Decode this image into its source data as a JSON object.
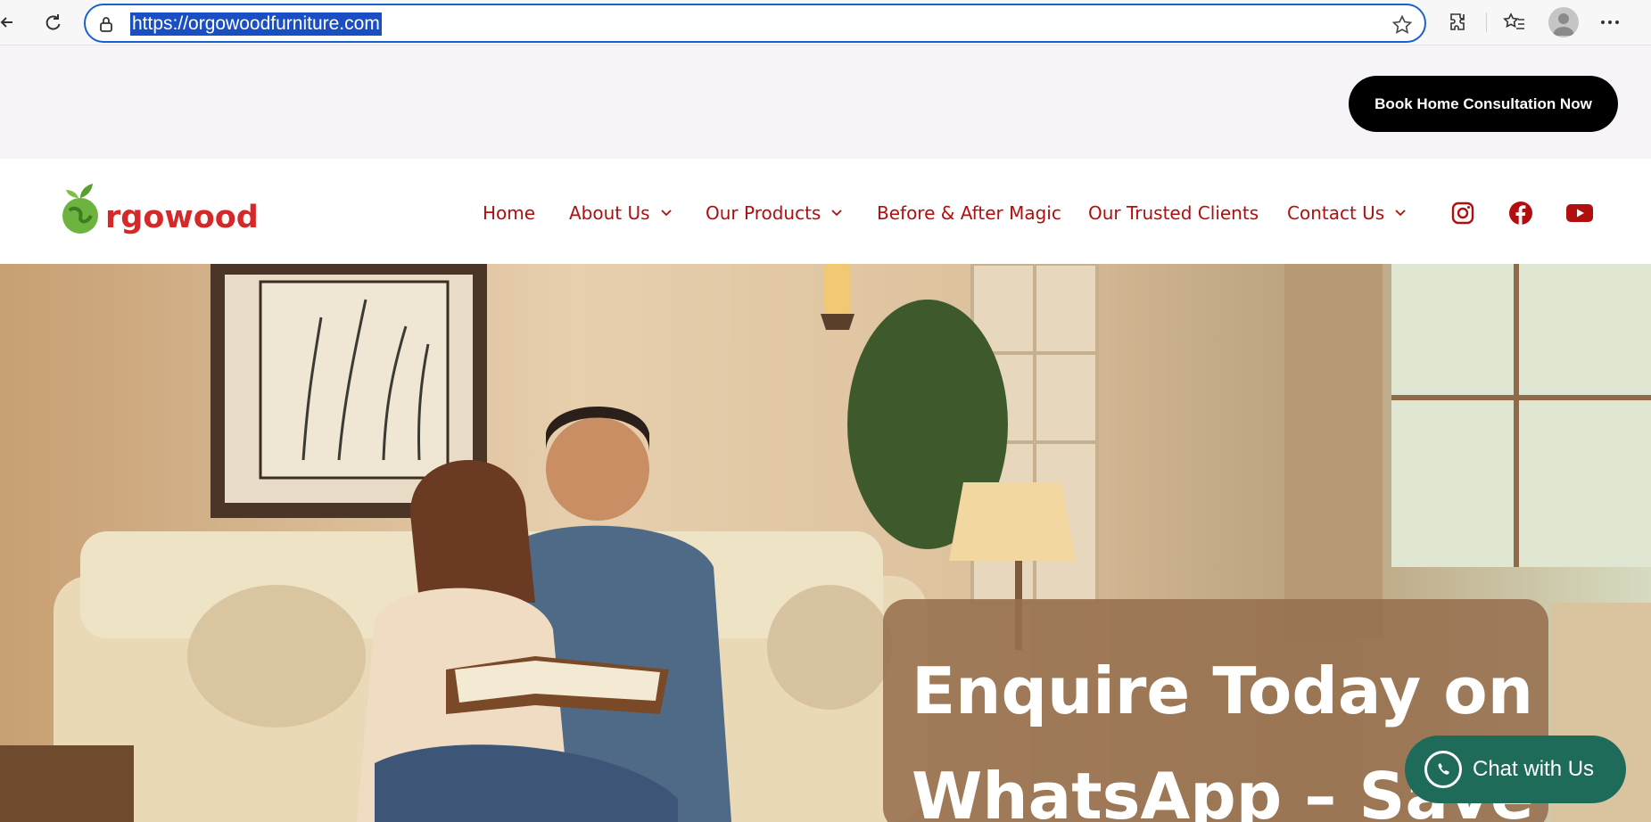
{
  "browser": {
    "url": "https://orgowoodfurniture.com",
    "icons": [
      "back-icon",
      "refresh-icon",
      "lock-icon",
      "favorite-star-icon",
      "extensions-icon",
      "favorites-icon",
      "profile-icon",
      "more-icon"
    ]
  },
  "topbar": {
    "cta_label": "Book Home Consultation Now"
  },
  "header": {
    "logo_text": "rgowood",
    "nav": {
      "home": "Home",
      "about": "About Us",
      "products": "Our Products",
      "before_after": "Before & After Magic",
      "clients": "Our Trusted Clients",
      "contact": "Contact Us"
    },
    "social_icons": [
      "instagram-icon",
      "facebook-icon",
      "youtube-icon"
    ]
  },
  "hero": {
    "heading_line1": "Enquire Today on",
    "heading_line2": "WhatsApp – Save"
  },
  "chat": {
    "label": "Chat with Us"
  },
  "colors": {
    "nav_text": "#b10f0f",
    "logo_red": "#d62828",
    "cta_bg": "#000000",
    "chat_bg": "#1f6b5a",
    "address_focus": "#1a5fd0"
  }
}
